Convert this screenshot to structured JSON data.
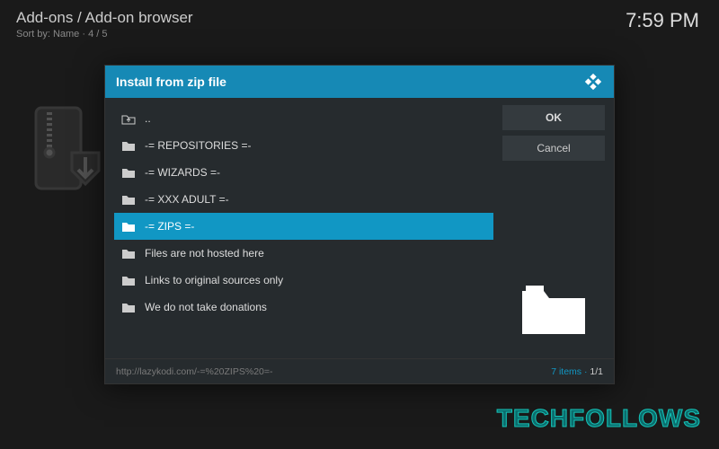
{
  "header": {
    "breadcrumb": "Add-ons / Add-on browser",
    "sort_label": "Sort by: Name",
    "sort_sep": "·",
    "sort_pos": "4 / 5",
    "clock": "7:59 PM"
  },
  "dialog": {
    "title": "Install from zip file",
    "items": [
      {
        "label": "..",
        "type": "up",
        "selected": false
      },
      {
        "label": "-= REPOSITORIES  =-",
        "type": "folder",
        "selected": false
      },
      {
        "label": "-= WIZARDS =-",
        "type": "folder",
        "selected": false
      },
      {
        "label": "-= XXX ADULT =-",
        "type": "folder",
        "selected": false
      },
      {
        "label": "-= ZIPS =-",
        "type": "folder",
        "selected": true
      },
      {
        "label": "Files are not hosted here",
        "type": "folder",
        "selected": false
      },
      {
        "label": "Links to original sources only",
        "type": "folder",
        "selected": false
      },
      {
        "label": "We do not take donations",
        "type": "folder",
        "selected": false
      }
    ],
    "buttons": {
      "ok": "OK",
      "cancel": "Cancel"
    },
    "footer": {
      "path": "http://lazykodi.com/-=%20ZIPS%20=-",
      "count": "7 items",
      "sep": "·",
      "page": "1/1"
    }
  },
  "watermark": "TECHFOLLOWS"
}
